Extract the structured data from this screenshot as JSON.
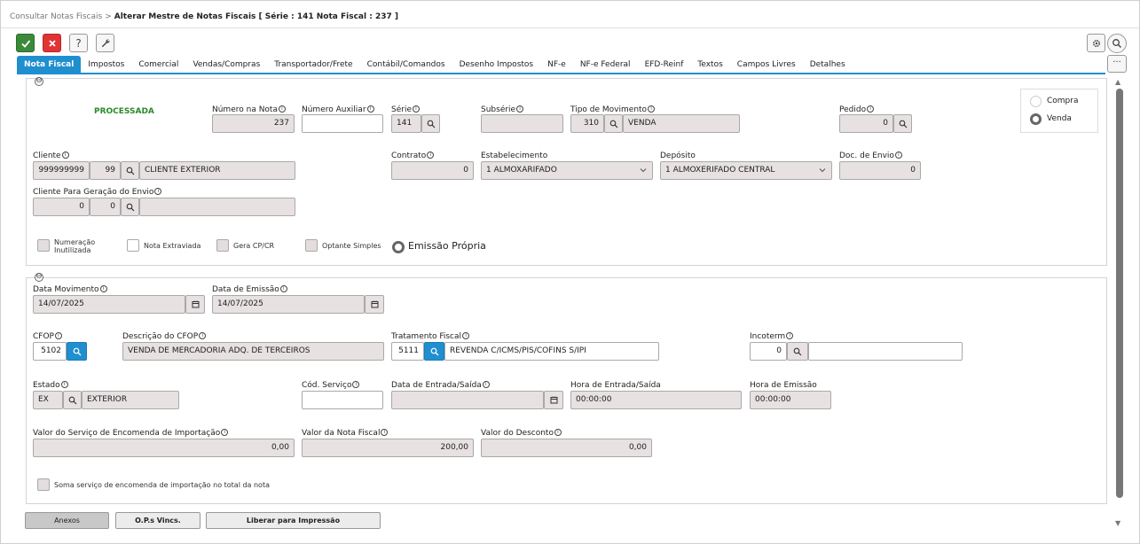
{
  "breadcrumb": {
    "parent": "Consultar Notas Fiscais",
    "separator": ">",
    "current": "Alterar Mestre de Notas Fiscais [ Série : 141 Nota Fiscal : 237 ]"
  },
  "toolbar": {
    "confirm_icon": "check-icon",
    "cancel_icon": "close-icon",
    "help_label": "?",
    "tools_icon": "wrench-icon",
    "settings_icon": "gear-icon",
    "search_icon": "search-icon",
    "more_label": "···"
  },
  "tabs": [
    {
      "label": "Nota Fiscal",
      "active": true
    },
    {
      "label": "Impostos"
    },
    {
      "label": "Comercial"
    },
    {
      "label": "Vendas/Compras"
    },
    {
      "label": "Transportador/Frete"
    },
    {
      "label": "Contábil/Comandos"
    },
    {
      "label": "Desenho Impostos"
    },
    {
      "label": "NF-e"
    },
    {
      "label": "NF-e Federal"
    },
    {
      "label": "EFD-Reinf"
    },
    {
      "label": "Textos"
    },
    {
      "label": "Campos Livres"
    },
    {
      "label": "Detalhes"
    }
  ],
  "header_panel": {
    "collapse_label": "⊖",
    "status": "PROCESSADA",
    "numero_nota": {
      "label": "Número na Nota",
      "value": "237"
    },
    "numero_auxiliar": {
      "label": "Número Auxiliar",
      "value": ""
    },
    "serie": {
      "label": "Série",
      "value": "141"
    },
    "subserie": {
      "label": "Subsérie",
      "value": ""
    },
    "tipo_movimento": {
      "label": "Tipo de Movimento",
      "code": "310",
      "description": "VENDA"
    },
    "pedido": {
      "label": "Pedido",
      "value": "0"
    },
    "movement_type": {
      "options": [
        "Compra",
        "Venda"
      ],
      "selected": "Venda"
    },
    "cliente": {
      "label": "Cliente",
      "code": "999999999",
      "branch": "99",
      "name": "CLIENTE EXTERIOR"
    },
    "contrato": {
      "label": "Contrato",
      "value": "0"
    },
    "estabelecimento": {
      "label": "Estabelecimento",
      "value": "1 ALMOXARIFADO"
    },
    "deposito": {
      "label": "Depósito",
      "value": "1 ALMOXERIFADO CENTRAL"
    },
    "doc_envio": {
      "label": "Doc. de Envio",
      "value": "0"
    },
    "cliente_envio": {
      "label": "Cliente Para Geração do Envio",
      "code": "0",
      "branch": "0",
      "name": ""
    },
    "checkboxes": [
      {
        "label_line1": "Numeração",
        "label_line2": "Inutilizada",
        "checked": false
      },
      {
        "label_line1": "Nota Extraviada",
        "label_line2": "",
        "checked": false
      },
      {
        "label_line1": "Gera CP/CR",
        "label_line2": "",
        "checked": false
      },
      {
        "label_line1": "Optante Simples",
        "label_line2": "",
        "checked": false
      }
    ],
    "emissao_propria": "Emissão Própria"
  },
  "detail_panel": {
    "collapse_label": "⊖",
    "data_movimento": {
      "label": "Data Movimento",
      "value": "14/07/2025"
    },
    "data_emissao": {
      "label": "Data de Emissão",
      "value": "14/07/2025"
    },
    "cfop": {
      "label": "CFOP",
      "value": "5102"
    },
    "descricao_cfop": {
      "label": "Descrição do CFOP",
      "value": "VENDA DE MERCADORIA ADQ. DE TERCEIROS"
    },
    "tratamento_fiscal": {
      "label": "Tratamento Fiscal",
      "code": "5111",
      "description": "REVENDA C/ICMS/PIS/COFINS S/IPI"
    },
    "incoterm": {
      "label": "Incoterm",
      "code": "0",
      "description": ""
    },
    "estado": {
      "label": "Estado",
      "code": "EX",
      "name": "EXTERIOR"
    },
    "cod_servico": {
      "label": "Cód. Serviço",
      "value": ""
    },
    "data_entrada_saida": {
      "label": "Data de Entrada/Saída",
      "value": ""
    },
    "hora_entrada_saida": {
      "label": "Hora de Entrada/Saída",
      "value": "00:00:00"
    },
    "hora_emissao": {
      "label": "Hora de Emissão",
      "value": "00:00:00"
    },
    "valor_servico_encomenda": {
      "label": "Valor do Serviço de Encomenda de Importação",
      "value": "0,00"
    },
    "valor_nota": {
      "label": "Valor da Nota Fiscal",
      "value": "200,00"
    },
    "valor_desconto": {
      "label": "Valor do Desconto",
      "value": "0,00"
    },
    "soma_servico": {
      "label": "Soma serviço de encomenda de importação no total da nota",
      "checked": false
    }
  },
  "footer_buttons": {
    "anexos": "Anexos",
    "ops_vincs": "O.P.s Vincs.",
    "liberar": "Liberar para Impressão"
  },
  "colors": {
    "accent": "#1f8fcf",
    "ok": "#3a8a3a",
    "cancel": "#e03434",
    "status": "#2a8a2a"
  }
}
